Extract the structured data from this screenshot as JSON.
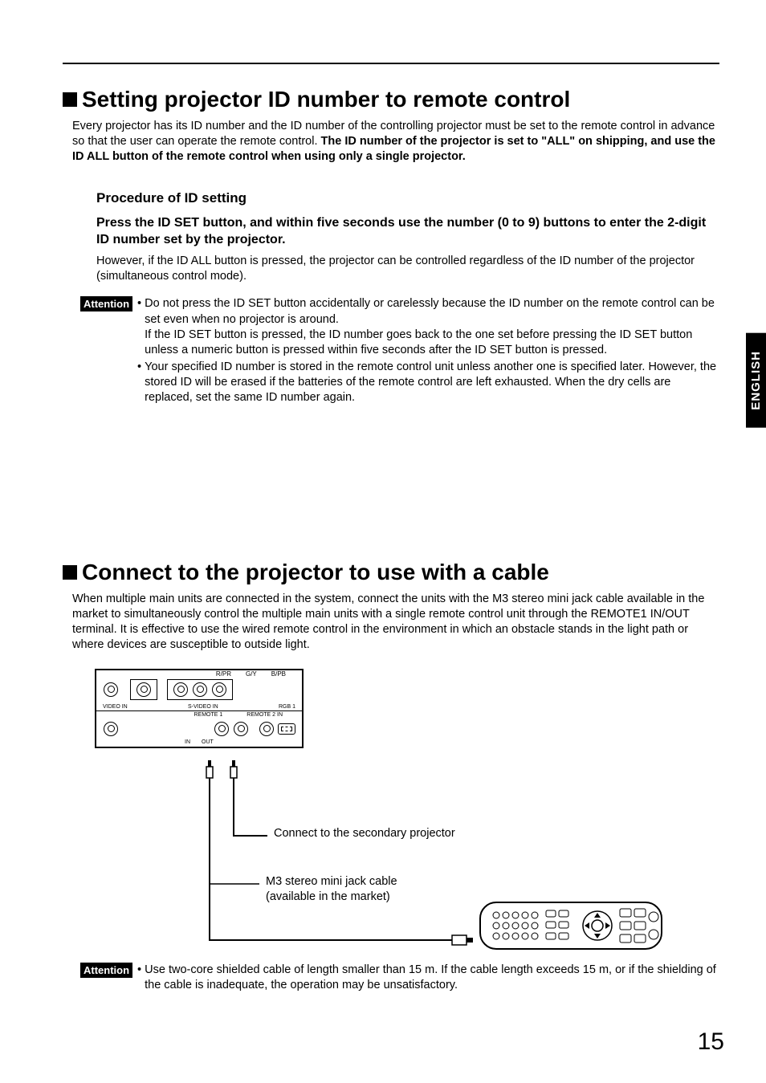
{
  "language_tab": "ENGLISH",
  "page_number": "15",
  "section1": {
    "title": "Setting projector ID number to remote control",
    "intro_plain": "Every projector has its ID number and the ID number of the controlling projector must be set to the remote control in advance so that the user can operate the remote control. ",
    "intro_bold": "The ID number of the projector is set to \"ALL\" on shipping, and use the ID ALL button of the remote control when using only a single projector.",
    "sub_heading": "Procedure of ID setting",
    "step": "Press the ID SET button, and within five seconds use the number (0 to 9) buttons to enter the 2-digit ID number set by the projector.",
    "step_body": "However, if the ID ALL button is pressed, the projector can be controlled regardless of the ID number of the projector (simultaneous control mode).",
    "attention_label": "Attention",
    "attention_items": [
      "Do not press the ID SET button accidentally or carelessly because the ID number on the remote control can be set even when no projector is around.\nIf the ID SET button is pressed, the ID number goes back to the one set before pressing the ID SET button unless a numeric button is pressed within five seconds after the ID SET button is pressed.",
      "Your specified ID number is stored in the remote control unit unless another one is specified later. However, the stored ID will be erased if the batteries of the remote control are left exhausted. When the dry cells are replaced, set the same ID number again."
    ]
  },
  "section2": {
    "title": "Connect to the projector to use with a cable",
    "intro": "When multiple main units are connected in the system, connect the units with the M3 stereo mini jack cable available in the market to simultaneously control the multiple main units with a single remote control unit through the REMOTE1 IN/OUT terminal. It is effective to use the wired remote control in the environment in which an obstacle stands in the light path or where devices are susceptible to outside light.",
    "panel_labels": {
      "r_pr": "R/PR",
      "g_y": "G/Y",
      "b_pb": "B/PB",
      "video_in": "VIDEO IN",
      "svideo_in": "S-VIDEO IN",
      "rgb1": "RGB 1",
      "remote1": "REMOTE 1",
      "remote2in": "REMOTE 2 IN",
      "in": "IN",
      "out": "OUT"
    },
    "captions": {
      "secondary": "Connect to the secondary projector",
      "cable": "M3 stereo mini jack cable (available in the market)"
    },
    "attention_label": "Attention",
    "attention_items": [
      "Use two-core shielded cable of length smaller than 15 m. If the cable length exceeds 15 m, or if the shielding of the cable is inadequate, the operation may be unsatisfactory."
    ]
  }
}
